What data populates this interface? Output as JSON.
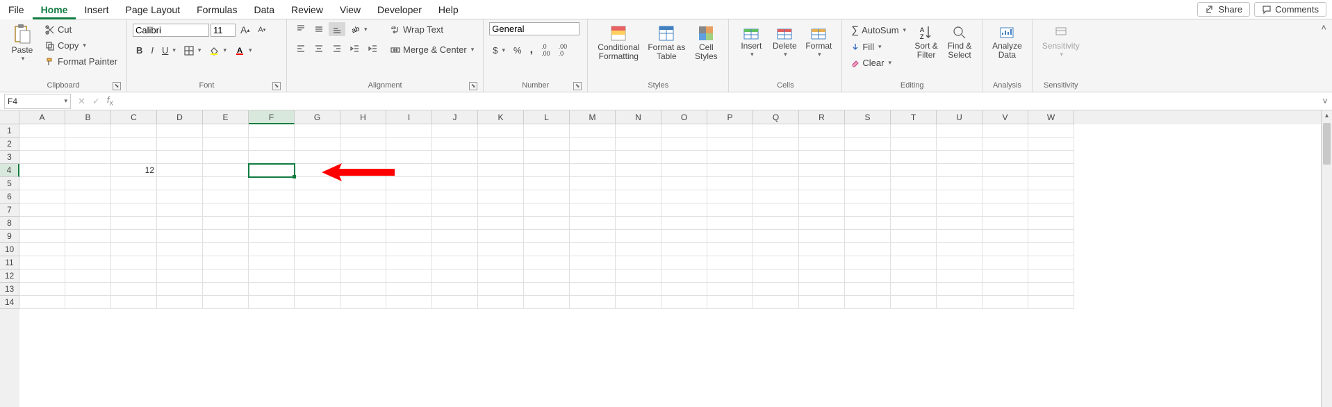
{
  "tabs": {
    "items": [
      "File",
      "Home",
      "Insert",
      "Page Layout",
      "Formulas",
      "Data",
      "Review",
      "View",
      "Developer",
      "Help"
    ],
    "active_index": 1
  },
  "top_actions": {
    "share": "Share",
    "comments": "Comments"
  },
  "ribbon": {
    "clipboard": {
      "paste": "Paste",
      "cut": "Cut",
      "copy": "Copy",
      "format_painter": "Format Painter",
      "label": "Clipboard"
    },
    "font": {
      "name": "Calibri",
      "size": "11",
      "label": "Font"
    },
    "alignment": {
      "wrap_text": "Wrap Text",
      "merge_center": "Merge & Center",
      "label": "Alignment"
    },
    "number": {
      "format": "General",
      "label": "Number"
    },
    "styles": {
      "conditional": "Conditional\nFormatting",
      "table": "Format as\nTable",
      "cell": "Cell\nStyles",
      "label": "Styles"
    },
    "cells": {
      "insert": "Insert",
      "delete": "Delete",
      "format": "Format",
      "label": "Cells"
    },
    "editing": {
      "autosum": "AutoSum",
      "fill": "Fill",
      "clear": "Clear",
      "sort_filter": "Sort &\nFilter",
      "find_select": "Find &\nSelect",
      "label": "Editing"
    },
    "analysis": {
      "analyze": "Analyze\nData",
      "label": "Analysis"
    },
    "sensitivity": {
      "btn": "Sensitivity",
      "label": "Sensitivity"
    }
  },
  "formula_bar": {
    "name_box": "F4",
    "formula": ""
  },
  "grid": {
    "columns": [
      "A",
      "B",
      "C",
      "D",
      "E",
      "F",
      "G",
      "H",
      "I",
      "J",
      "K",
      "L",
      "M",
      "N",
      "O",
      "P",
      "Q",
      "R",
      "S",
      "T",
      "U",
      "V",
      "W"
    ],
    "rows": [
      1,
      2,
      3,
      4,
      5,
      6,
      7,
      8,
      9,
      10,
      11,
      12,
      13,
      14
    ],
    "selected_cell": {
      "col": "F",
      "row": 4
    },
    "cells": {
      "C4": "12"
    }
  },
  "annotation": {
    "type": "arrow-left",
    "color": "#ff0000",
    "target": "F4"
  }
}
